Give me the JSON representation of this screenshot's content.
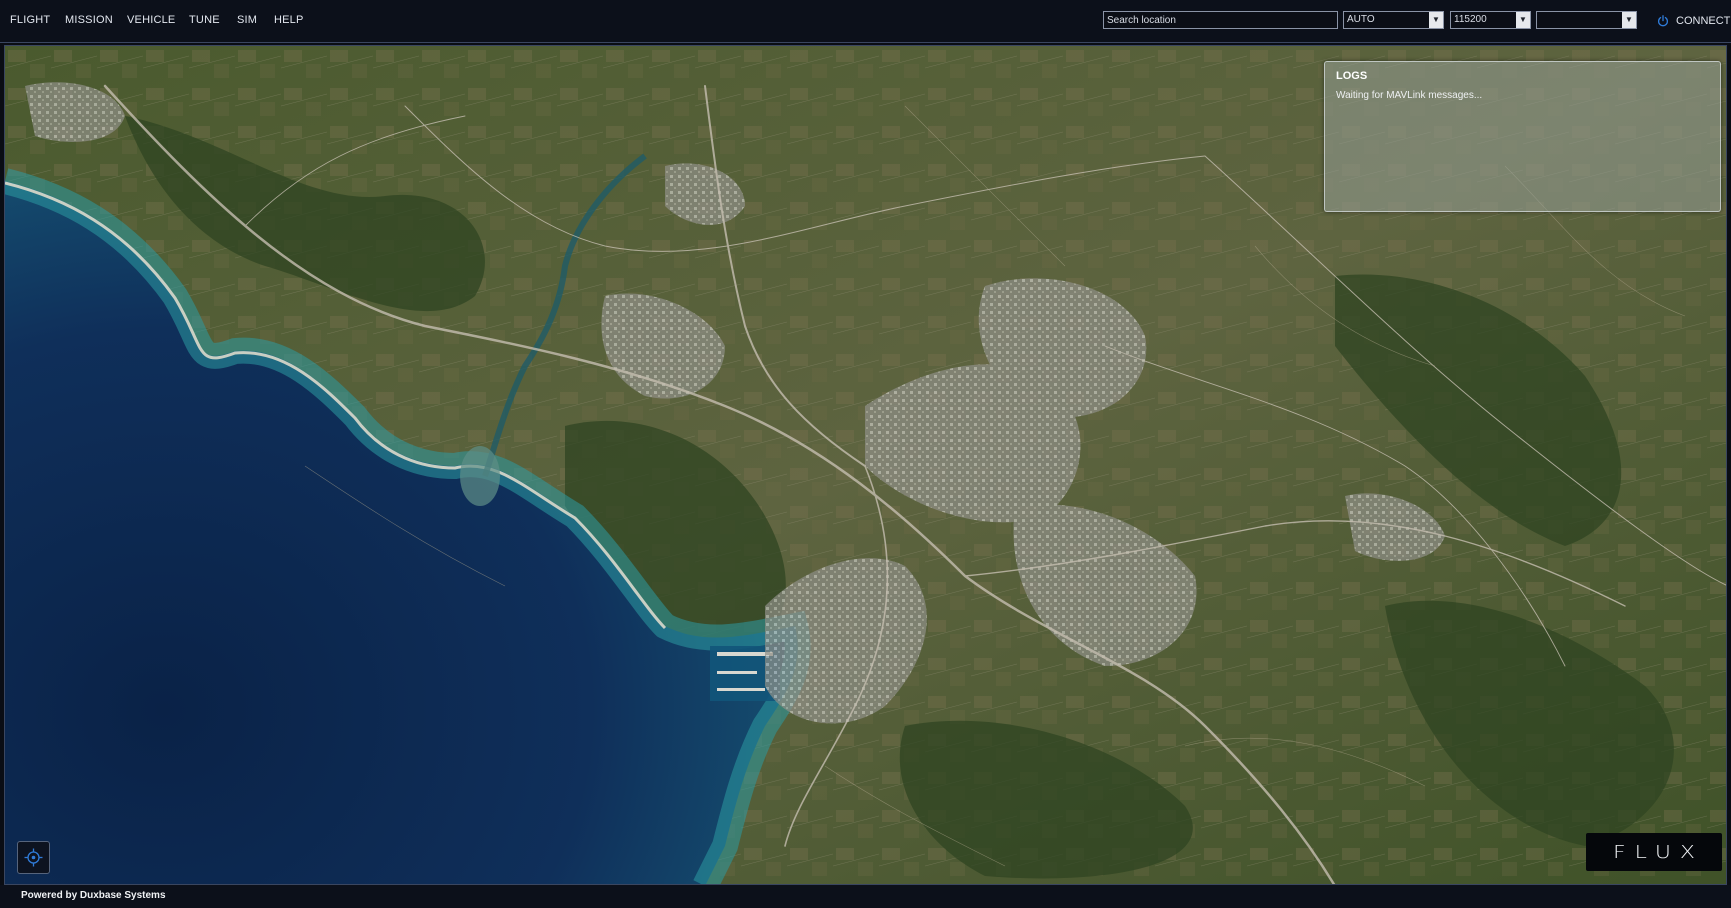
{
  "menu": {
    "items": [
      {
        "id": "flight",
        "label": "FLIGHT"
      },
      {
        "id": "mission",
        "label": "MISSION"
      },
      {
        "id": "vehicle",
        "label": "VEHICLE"
      },
      {
        "id": "tune",
        "label": "TUNE"
      },
      {
        "id": "sim",
        "label": "SIM"
      },
      {
        "id": "help",
        "label": "HELP"
      }
    ]
  },
  "toolbar": {
    "search_placeholder": "Search location",
    "mode_value": "AUTO",
    "baud_value": "115200",
    "port_value": "",
    "connect_label": "CONNECT",
    "connect_icon": "power-icon"
  },
  "logs": {
    "title": "LOGS",
    "message": "Waiting for MAVLink messages..."
  },
  "map": {
    "type": "satellite",
    "locate_icon": "crosshair-icon"
  },
  "logo": {
    "text": "FLUX"
  },
  "footer": {
    "text": "Powered by Duxbase Systems"
  },
  "colors": {
    "bar_background": "#0c101a",
    "accent": "#2f7bd8",
    "sea_deep": "#0d2a52",
    "sea_shallow": "#2c8c98",
    "land": "#55603a",
    "urban": "#8d8d84"
  }
}
